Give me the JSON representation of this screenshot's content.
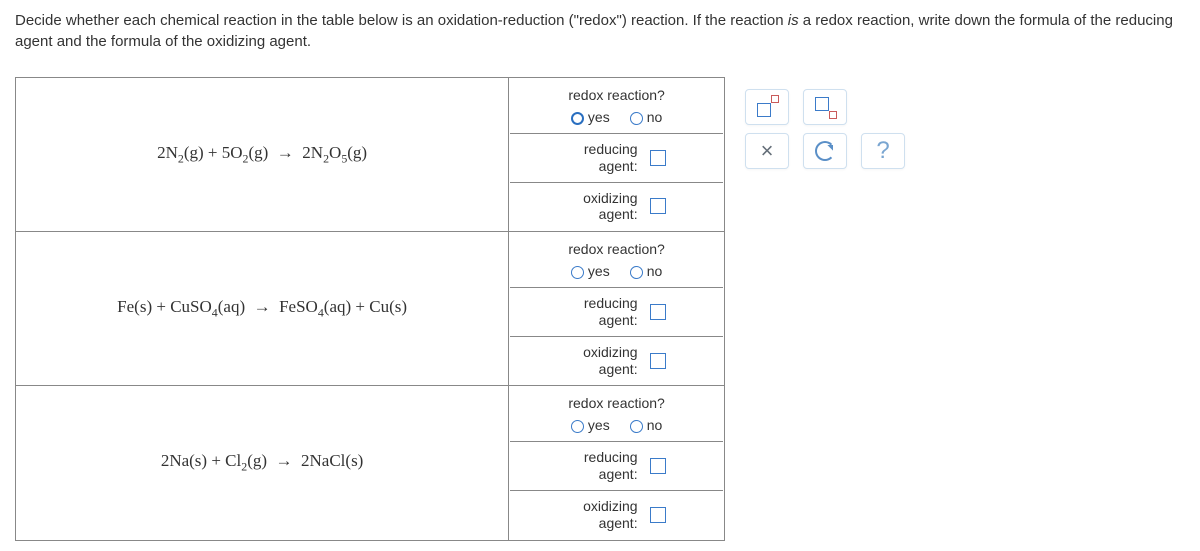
{
  "instructions_pre": "Decide whether each chemical reaction in the table below is an oxidation-reduction (\"redox\") reaction. If the reaction ",
  "instructions_em": "is",
  "instructions_post": " a redox reaction, write down the formula of the reducing agent and the formula of the oxidizing agent.",
  "labels": {
    "redox_question": "redox reaction?",
    "yes": "yes",
    "no": "no",
    "reducing": "reducing agent:",
    "oxidizing": "oxidizing agent:"
  },
  "reactions": [
    {
      "equation_html": "2N<sub>2</sub>(g) + 5O<sub>2</sub>(g) &nbsp;&rarr;&nbsp; 2N<sub>2</sub>O<sub>5</sub>(g)",
      "yes_selected_ring": true,
      "reducing_value": "",
      "oxidizing_value": ""
    },
    {
      "equation_html": "Fe(s) + CuSO<sub>4</sub>(aq) &nbsp;&rarr;&nbsp; FeSO<sub>4</sub>(aq) + Cu(s)",
      "yes_selected_ring": false,
      "reducing_value": "",
      "oxidizing_value": ""
    },
    {
      "equation_html": "2Na(s) + Cl<sub>2</sub>(g) &nbsp;&rarr;&nbsp; 2NaCl(s)",
      "yes_selected_ring": false,
      "reducing_value": "",
      "oxidizing_value": ""
    }
  ],
  "tools": {
    "superscript": "superscript",
    "subscript": "subscript",
    "clear": "clear",
    "reset": "reset",
    "help": "?"
  }
}
